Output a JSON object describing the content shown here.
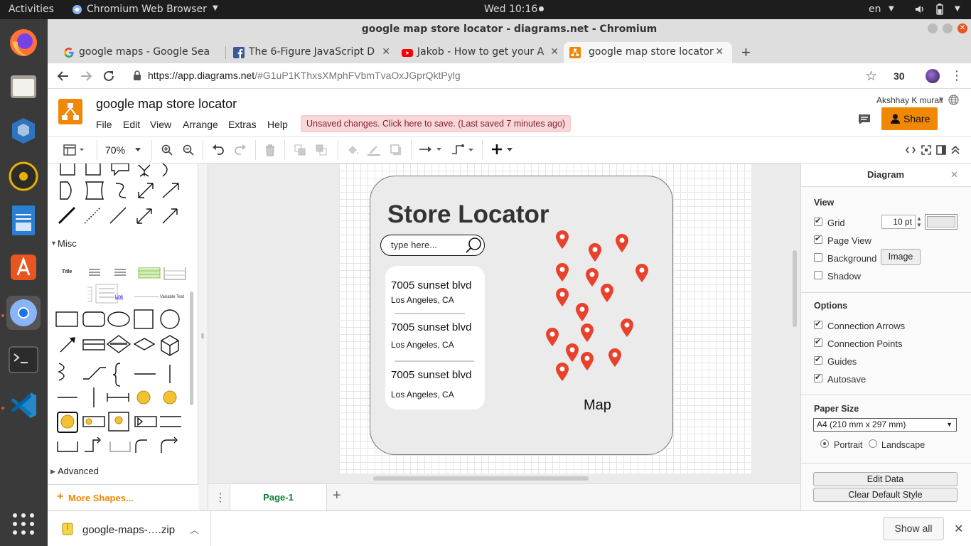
{
  "system": {
    "activities": "Activities",
    "app_name": "Chromium Web Browser",
    "clock": "Wed 10:16",
    "language": "en"
  },
  "window": {
    "title": "google map store locator - diagrams.net - Chromium"
  },
  "tabs": [
    {
      "label": "google maps - Google Sea",
      "icon": "google-icon"
    },
    {
      "label": "The 6-Figure JavaScript D",
      "icon": "facebook-icon"
    },
    {
      "label": "Jakob - How to get your A",
      "icon": "youtube-icon"
    },
    {
      "label": "google map store locator",
      "icon": "drawio-icon"
    }
  ],
  "address_bar": {
    "url_prefix": "https://app.diagrams.net",
    "url_rest": "/#G1uP1KThxsXMphFVbmTvaOxJGprQktPylg",
    "extension_count": "30"
  },
  "drawio": {
    "doc_title": "google map store locator",
    "menu": [
      "File",
      "Edit",
      "View",
      "Arrange",
      "Extras",
      "Help"
    ],
    "unsaved_notice": "Unsaved changes. Click here to save. (Last saved 7 minutes ago)",
    "user": "Akshhay K murali",
    "share": "Share",
    "zoom": "70%"
  },
  "shapes_panel": {
    "misc_label": "Misc",
    "advanced_label": "Advanced",
    "more_shapes": "More Shapes...",
    "thumb_title": "Title",
    "thumb_link": "Link",
    "thumb_variable": "Variable Text"
  },
  "mockup": {
    "title": "Store Locator",
    "search_placeholder": "type here...",
    "results": [
      {
        "street": "7005 sunset blvd",
        "city": "Los Angeles, CA"
      },
      {
        "street": "7005 sunset blvd",
        "city": "Los Angeles, CA"
      },
      {
        "street": "7005 sunset blvd",
        "city": "Los Angeles, CA"
      }
    ],
    "map_label": "Map"
  },
  "page_tab": "Page-1",
  "format_panel": {
    "title": "Diagram",
    "view_header": "View",
    "grid": "Grid",
    "grid_size": "10 pt",
    "page_view": "Page View",
    "background": "Background",
    "image_button": "Image",
    "shadow": "Shadow",
    "options_header": "Options",
    "connection_arrows": "Connection Arrows",
    "connection_points": "Connection Points",
    "guides": "Guides",
    "autosave": "Autosave",
    "paper_size_header": "Paper Size",
    "paper_size": "A4 (210 mm x 297 mm)",
    "portrait": "Portrait",
    "landscape": "Landscape",
    "edit_data": "Edit Data",
    "clear_default_style": "Clear Default Style"
  },
  "download": {
    "file": "google-maps-….zip",
    "show_all": "Show all"
  },
  "colors": {
    "accent_orange": "#f08705",
    "pin_red": "#e8412c",
    "unsaved_bg": "#f8d7da"
  }
}
